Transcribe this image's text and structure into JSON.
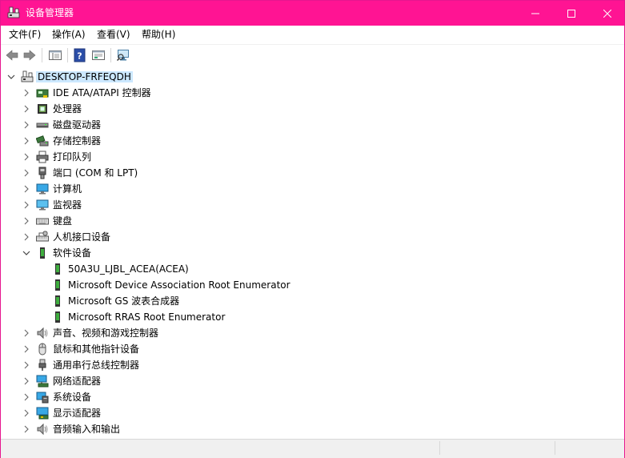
{
  "window": {
    "title": "设备管理器"
  },
  "menu": [
    {
      "label": "文件(F)"
    },
    {
      "label": "操作(A)"
    },
    {
      "label": "查看(V)"
    },
    {
      "label": "帮助(H)"
    }
  ],
  "tree": {
    "root": {
      "label": "DESKTOP-FRFEQDH",
      "expanded": true
    },
    "categories": [
      {
        "label": "IDE ATA/ATAPI 控制器",
        "icon": "ide-controller-icon",
        "expanded": false
      },
      {
        "label": "处理器",
        "icon": "processor-icon",
        "expanded": false
      },
      {
        "label": "磁盘驱动器",
        "icon": "disk-drive-icon",
        "expanded": false
      },
      {
        "label": "存储控制器",
        "icon": "storage-controller-icon",
        "expanded": false
      },
      {
        "label": "打印队列",
        "icon": "printer-icon",
        "expanded": false
      },
      {
        "label": "端口 (COM 和 LPT)",
        "icon": "port-icon",
        "expanded": false
      },
      {
        "label": "计算机",
        "icon": "computer-icon",
        "expanded": false
      },
      {
        "label": "监视器",
        "icon": "monitor-icon",
        "expanded": false
      },
      {
        "label": "键盘",
        "icon": "keyboard-icon",
        "expanded": false
      },
      {
        "label": "人机接口设备",
        "icon": "hid-icon",
        "expanded": false
      },
      {
        "label": "软件设备",
        "icon": "software-device-icon",
        "expanded": true,
        "children": [
          {
            "label": "50A3U_LJBL_ACEA(ACEA)"
          },
          {
            "label": "Microsoft Device Association Root Enumerator"
          },
          {
            "label": "Microsoft GS 波表合成器"
          },
          {
            "label": "Microsoft RRAS Root Enumerator"
          }
        ]
      },
      {
        "label": "声音、视频和游戏控制器",
        "icon": "speaker-icon",
        "expanded": false
      },
      {
        "label": "鼠标和其他指针设备",
        "icon": "mouse-icon",
        "expanded": false
      },
      {
        "label": "通用串行总线控制器",
        "icon": "usb-icon",
        "expanded": false
      },
      {
        "label": "网络适配器",
        "icon": "network-adapter-icon",
        "expanded": false
      },
      {
        "label": "系统设备",
        "icon": "system-device-icon",
        "expanded": false
      },
      {
        "label": "显示适配器",
        "icon": "display-adapter-icon",
        "expanded": false
      },
      {
        "label": "音频输入和输出",
        "icon": "audio-io-icon",
        "expanded": false
      }
    ]
  },
  "colors": {
    "titlebar": "#ff1493",
    "selection": "#cce8ff"
  }
}
